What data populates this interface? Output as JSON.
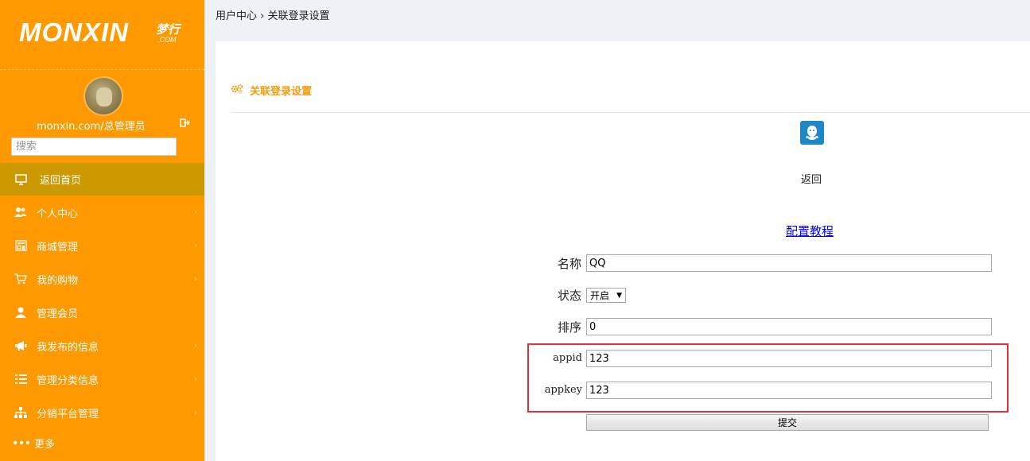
{
  "brand": {
    "logo_text": "MONXIN",
    "logo_cn": "梦行",
    "logo_com": ".COM"
  },
  "user": {
    "name": "monxin.com/总管理员"
  },
  "search": {
    "placeholder": "搜索"
  },
  "sidebar": {
    "items": [
      {
        "label": "返回首页",
        "icon": "monitor-icon",
        "active": true
      },
      {
        "label": "个人中心",
        "icon": "users-icon"
      },
      {
        "label": "商城管理",
        "icon": "store-icon"
      },
      {
        "label": "我的购物",
        "icon": "cart-icon"
      },
      {
        "label": "管理会员",
        "icon": "user-icon"
      },
      {
        "label": "我发布的信息",
        "icon": "megaphone-icon"
      },
      {
        "label": "管理分类信息",
        "icon": "list-icon"
      },
      {
        "label": "分销平台管理",
        "icon": "sitemap-icon"
      },
      {
        "label": "更多",
        "icon": "more-dots-icon"
      }
    ]
  },
  "breadcrumb": {
    "home": "用户中心",
    "separator": "›",
    "current": "关联登录设置"
  },
  "panel": {
    "title": "关联登录设置",
    "back_label": "返回",
    "config_link": "配置教程"
  },
  "form": {
    "name_label": "名称",
    "name_value": "QQ",
    "status_label": "状态",
    "status_value": "开启",
    "sort_label": "排序",
    "sort_value": "0",
    "appid_label": "appid",
    "appid_value": "123",
    "appkey_label": "appkey",
    "appkey_value": "123",
    "submit_label": "提交"
  },
  "colors": {
    "sidebar_bg": "#ff9900",
    "sidebar_active": "#cc9900",
    "accent": "#f39c12",
    "highlight_border": "#e0313a",
    "qq_icon_bg": "#1e88c7"
  }
}
